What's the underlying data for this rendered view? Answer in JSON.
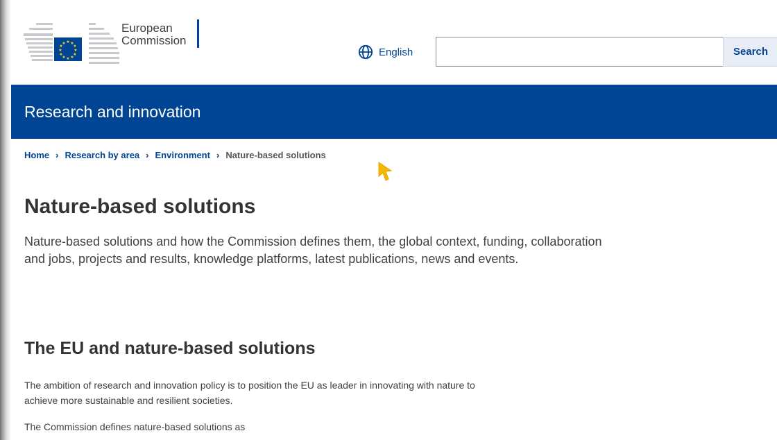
{
  "header": {
    "logo": {
      "line1": "European",
      "line2": "Commission"
    },
    "language": {
      "label": "English",
      "icon": "globe-icon"
    },
    "search": {
      "value": "",
      "placeholder": "",
      "button_label": "Search"
    }
  },
  "site": {
    "name": "Research and innovation"
  },
  "breadcrumb": {
    "items": [
      {
        "label": "Home"
      },
      {
        "label": "Research by area"
      },
      {
        "label": "Environment"
      }
    ],
    "current": "Nature-based solutions"
  },
  "content": {
    "title": "Nature-based solutions",
    "intro": "Nature-based solutions and how the Commission defines them, the global context, funding, collaboration and jobs, projects and results, knowledge platforms, latest publications, news and events.",
    "section_title": "The EU and nature-based solutions",
    "paragraphs": [
      "The ambition of research and innovation policy is to position the EU as leader in innovating with nature to achieve more sustainable and resilient societies.",
      "The Commission defines nature-based solutions as"
    ]
  },
  "colors": {
    "brand_blue": "#004494",
    "flag_yellow": "#ffd617",
    "cursor": "#f5b800"
  }
}
